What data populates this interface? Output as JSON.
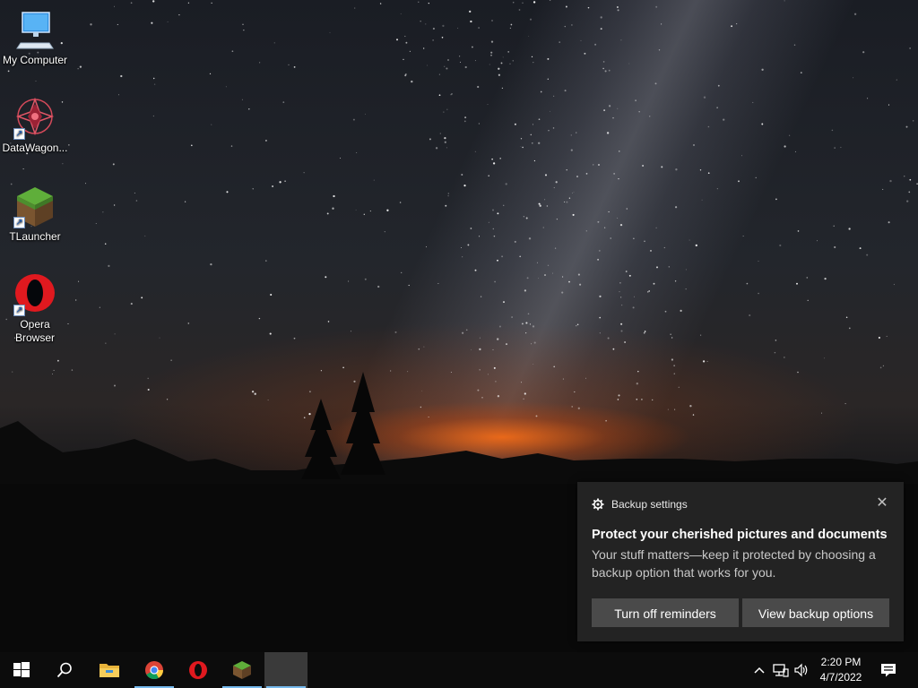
{
  "desktop": {
    "icons": [
      {
        "label": "My Computer",
        "icon": "computer-icon"
      },
      {
        "label": "DataWagon...",
        "icon": "datawagon-icon"
      },
      {
        "label": "TLauncher",
        "icon": "tlauncher-icon"
      },
      {
        "label": "Opera Browser",
        "icon": "opera-icon"
      }
    ]
  },
  "toast": {
    "app_name": "Backup settings",
    "title": "Protect your cherished pictures and documents",
    "body": "Your stuff matters—keep it protected by choosing a backup option that works for you.",
    "buttons": [
      "Turn off reminders",
      "View backup options"
    ],
    "close_glyph": "✕"
  },
  "taskbar": {
    "apps": [
      "start-icon",
      "search-icon",
      "file-explorer-icon",
      "chrome-icon",
      "opera-icon",
      "tlauncher-icon",
      "active-window"
    ],
    "time": "2:20 PM",
    "date": "4/7/2022",
    "accent": "#76b9ed"
  }
}
